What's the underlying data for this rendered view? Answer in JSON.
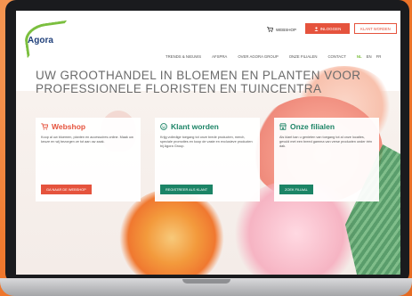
{
  "header": {
    "logo_text": "Agora",
    "webshop_label": "WEBSHOP",
    "login_label": "INLOGGEN",
    "client_label": "KLANT WORDEN"
  },
  "nav": {
    "items": [
      "TRENDS & NIEUWS",
      "AFSPRA",
      "OVER AGORA GROUP",
      "ONZE FILIALEN",
      "CONTACT"
    ],
    "languages": [
      "NL",
      "EN",
      "FR"
    ]
  },
  "hero": {
    "line1": "UW GROOTHANDEL IN BLOEMEN EN PLANTEN VOOR",
    "line2": "PROFESSIONELE FLORISTEN EN TUINCENTRA"
  },
  "cards": [
    {
      "title": "Webshop",
      "text": "Koop al uw bloemen, planten en accessoires online. Maak uw keuze en wij bezorgen ze tot aan uw zaak.",
      "button": "GA NAAR DE WEBSHOP"
    },
    {
      "title": "Klant worden",
      "text": "Krijg volledige toegang tot onze brede producten, merch, speciale promoties en koop de vaste en exclusieve producten bij Agora Group.",
      "button": "REGISTREER ALS KLANT"
    },
    {
      "title": "Onze filialen",
      "text": "Als klant kan u genieten van toegang tot al onze locaties, gevuld met een breed gamma van verse producten onder één dak.",
      "button": "ZOEK FILIAAL"
    }
  ],
  "colors": {
    "accent_red": "#e5533d",
    "accent_green": "#1c8466",
    "logo_green": "#7bbf3f",
    "background_orange": "#f07a2f"
  }
}
